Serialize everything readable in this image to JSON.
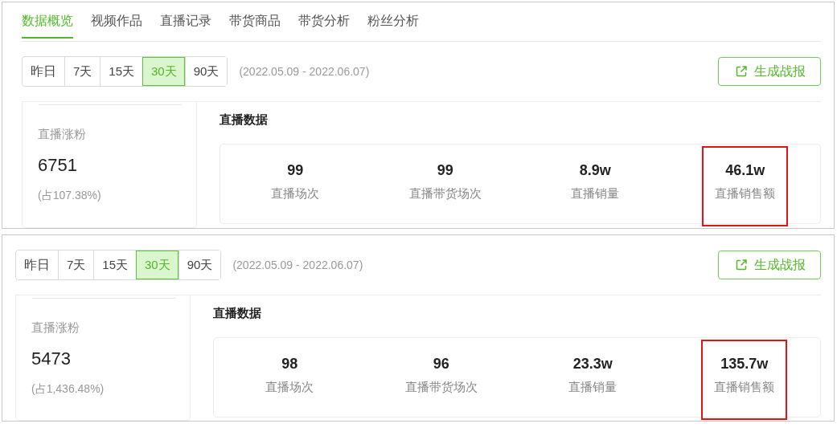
{
  "panels": [
    {
      "tabs": [
        {
          "label": "数据概览",
          "selected": true
        },
        {
          "label": "视频作品",
          "selected": false
        },
        {
          "label": "直播记录",
          "selected": false
        },
        {
          "label": "带货商品",
          "selected": false
        },
        {
          "label": "带货分析",
          "selected": false
        },
        {
          "label": "粉丝分析",
          "selected": false
        }
      ],
      "periods": [
        {
          "label": "昨日",
          "selected": false
        },
        {
          "label": "7天",
          "selected": false
        },
        {
          "label": "15天",
          "selected": false
        },
        {
          "label": "30天",
          "selected": true
        },
        {
          "label": "90天",
          "selected": false
        }
      ],
      "date_range": "(2022.05.09 - 2022.06.07)",
      "report_button": "生成战报",
      "fans": {
        "label": "直播涨粉",
        "value": "6751",
        "share": "(占107.38%)"
      },
      "section_title": "直播数据",
      "stats": [
        {
          "value": "99",
          "label": "直播场次",
          "highlighted": false
        },
        {
          "value": "99",
          "label": "直播带货场次",
          "highlighted": false
        },
        {
          "value": "8.9w",
          "label": "直播销量",
          "highlighted": false
        },
        {
          "value": "46.1w",
          "label": "直播销售额",
          "highlighted": true
        }
      ]
    },
    {
      "periods": [
        {
          "label": "昨日",
          "selected": false
        },
        {
          "label": "7天",
          "selected": false
        },
        {
          "label": "15天",
          "selected": false
        },
        {
          "label": "30天",
          "selected": true
        },
        {
          "label": "90天",
          "selected": false
        }
      ],
      "date_range": "(2022.05.09 - 2022.06.07)",
      "report_button": "生成战报",
      "fans": {
        "label": "直播涨粉",
        "value": "5473",
        "share": "(占1,436.48%)"
      },
      "section_title": "直播数据",
      "stats": [
        {
          "value": "98",
          "label": "直播场次",
          "highlighted": false
        },
        {
          "value": "96",
          "label": "直播带货场次",
          "highlighted": false
        },
        {
          "value": "23.3w",
          "label": "直播销量",
          "highlighted": false
        },
        {
          "value": "135.7w",
          "label": "直播销售额",
          "highlighted": true
        }
      ]
    }
  ]
}
